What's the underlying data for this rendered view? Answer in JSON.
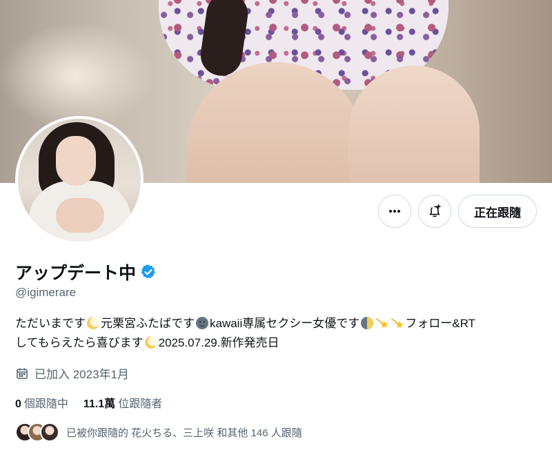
{
  "profile": {
    "display_name": "アップデート中",
    "handle": "@igimerare",
    "verified": true,
    "bio_line1": [
      {
        "type": "text",
        "value": "ただいまです"
      },
      {
        "type": "emoji",
        "icon": "crescent-moon-icon"
      },
      {
        "type": "text",
        "value": "元栗宮ふたばです"
      },
      {
        "type": "emoji",
        "icon": "new-moon-face-icon"
      },
      {
        "type": "text",
        "value": "kawaii専属セクシー女優です"
      },
      {
        "type": "emoji",
        "icon": "first-quarter-moon-icon"
      },
      {
        "type": "emoji",
        "icon": "shooting-star-icon"
      },
      {
        "type": "emoji",
        "icon": "shooting-star-icon"
      },
      {
        "type": "text",
        "value": "フォロー&RT"
      }
    ],
    "bio_line2": [
      {
        "type": "text",
        "value": "してもらえたら喜びます"
      },
      {
        "type": "emoji",
        "icon": "crescent-moon-icon"
      },
      {
        "type": "text",
        "value": "2025.07.29.新作発売日"
      }
    ],
    "joined": "已加入 2023年1月",
    "following_count": "0",
    "following_label": "個跟隨中",
    "followers_count": "11.1萬",
    "followers_label": "位跟隨者",
    "followed_by": "已被你跟隨的 花火ちる、三上咲 和其他 146 人跟隨"
  },
  "actions": {
    "more_icon": "more-horizontal-icon",
    "notify_icon": "bell-plus-icon",
    "follow_label": "正在跟隨"
  },
  "colors": {
    "verified": "#1d9bf0",
    "text_primary": "#0f1419",
    "text_secondary": "#536471",
    "border": "#cfd9de"
  }
}
